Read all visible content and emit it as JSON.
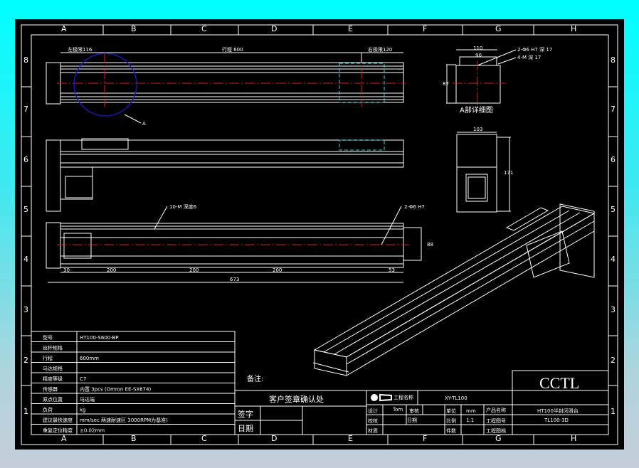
{
  "grid": {
    "columns": [
      "A",
      "B",
      "C",
      "D",
      "E",
      "F",
      "G",
      "H"
    ],
    "rows": [
      "8",
      "7",
      "6",
      "5",
      "4",
      "3",
      "2",
      "1"
    ]
  },
  "top_view": {
    "left_limit": "左极限116",
    "stroke": "行程 600",
    "right_limit": "右极限120",
    "detail_marker": "A"
  },
  "bottom_view": {
    "callout_left": "10-M 深度6",
    "callout_right": "2-Φ6 H7",
    "dims": [
      "30",
      "200",
      "200",
      "200",
      "53"
    ],
    "total": "673",
    "height": "88"
  },
  "detail_view": {
    "width": "110",
    "inner": "90",
    "callout1": "2-Φ6 H7 深 17",
    "callout2": "4-M 深 17",
    "height": "87",
    "caption": "A部详细图"
  },
  "end_view": {
    "width": "103",
    "height": "171"
  },
  "spec_table": [
    {
      "label": "型号",
      "value": "HT100-S600-BP"
    },
    {
      "label": "丝杆规格",
      "value": ""
    },
    {
      "label": "行程",
      "value": "600mm"
    },
    {
      "label": "马达规格",
      "value": ""
    },
    {
      "label": "精度等级",
      "value": "C7"
    },
    {
      "label": "传感器",
      "value": "内置 3pcs (Omron EE-SX674)"
    },
    {
      "label": "原点位置",
      "value": "马达端"
    },
    {
      "label": "负荷",
      "value": "kg"
    },
    {
      "label": "建议最快速度",
      "value": "mm/sec 两速耐速区 3000RPM为基准)"
    },
    {
      "label": "重复定位精度",
      "value": "±0.02mm"
    }
  ],
  "notes_label": "备注:",
  "customer": {
    "title": "客户签章确认处",
    "sign": "签字",
    "date": "日期"
  },
  "title_block": {
    "project_name_label": "工程名称",
    "project_name": "XY-TL100",
    "design_label": "设计",
    "design_value": "Tom",
    "review_label": "审核",
    "check_label": "校核",
    "date_label": "日期",
    "material_label": "材质",
    "unit_label": "单位",
    "unit": "mm",
    "scale_label": "比例",
    "scale": "1:1",
    "qty_label": "件数",
    "product_name_label": "产品名称",
    "product_name": "HT100半封闭滑台",
    "drawing_no_label": "工程图号",
    "drawing_no": "TL100-3D",
    "drawing_ver_label": "工程图档",
    "company": "CCTL"
  },
  "colors": {
    "bg": "#000000",
    "line": "#ffffff",
    "center": "#d02020",
    "circle": "#1a1aa8",
    "hidden": "#40d0d0"
  }
}
